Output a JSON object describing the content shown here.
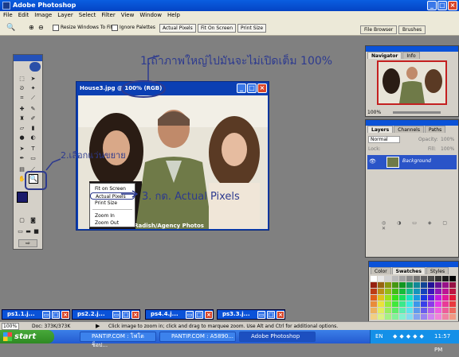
{
  "app": {
    "title": "Adobe Photoshop"
  },
  "menu": [
    "File",
    "Edit",
    "Image",
    "Layer",
    "Select",
    "Filter",
    "View",
    "Window",
    "Help"
  ],
  "options_bar": {
    "resize_windows": "Resize Windows To Fit",
    "ignore_palettes": "Ignore Palettes",
    "actual_pixels": "Actual Pixels",
    "fit_on_screen": "Fit On Screen",
    "print_size": "Print Size",
    "file_browser": "File Browser",
    "brushes": "Brushes"
  },
  "document": {
    "title": "House3.jpg @ 100% (RGB)",
    "caption": "na Radish/Agency Photos"
  },
  "context_menu": {
    "items": [
      "Fit on Screen",
      "Actual Pixels",
      "Print Size",
      "Zoom In",
      "Zoom Out"
    ]
  },
  "annotations": {
    "a1": "1.ถ้าภาพใหญ่ไปมันจะไม่เปิดเต็ม 100%",
    "a2": "2.เลือกแว่นขยาย",
    "a3": "3. กด. Actual Pixels"
  },
  "navigator": {
    "tabs": [
      "Navigator",
      "Info"
    ],
    "zoom": "100%"
  },
  "layers": {
    "tabs": [
      "Layers",
      "Channels",
      "Paths"
    ],
    "blend_mode": "Normal",
    "opacity_label": "Opacity:",
    "opacity": "100%",
    "lock_label": "Lock:",
    "fill_label": "Fill:",
    "fill": "100%",
    "layer_name": "Background"
  },
  "swatches": {
    "tabs": [
      "Color",
      "Swatches",
      "Styles"
    ]
  },
  "minimized_docs": [
    "ps1.1.j...",
    "ps2.2.j...",
    "ps4.4.j...",
    "ps3.3.j..."
  ],
  "status": {
    "zoom": "100%",
    "doc": "Doc: 373K/373K",
    "hint": "Click image to zoom in; click and drag to marquee zoom. Use Alt and Ctrl for additional options."
  },
  "taskbar": {
    "start": "start",
    "items": [
      "PANTIP.COM : โฟโตช็อป...",
      "PANTIP.COM : A5890...",
      "Adobe Photoshop"
    ],
    "lang": "EN",
    "time": "11:57 PM"
  },
  "colors": {
    "accent": "#0a52d8",
    "annotation": "#2d3a8f"
  }
}
